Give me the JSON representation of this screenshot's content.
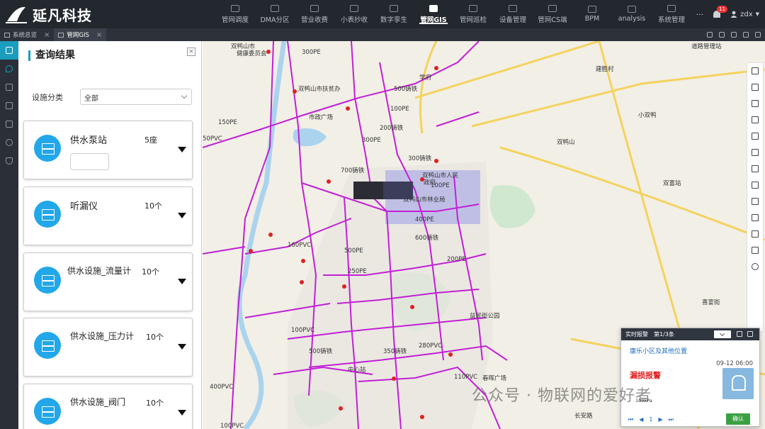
{
  "app": {
    "title": "延凡科技"
  },
  "nav": {
    "items": [
      {
        "label": "管网调度"
      },
      {
        "label": "DMA分区"
      },
      {
        "label": "营业收费"
      },
      {
        "label": "小表抄收"
      },
      {
        "label": "数字孪生"
      },
      {
        "label": "管网GIS",
        "active": true
      },
      {
        "label": "管网巡检"
      },
      {
        "label": "设备管理"
      },
      {
        "label": "管网CS端"
      },
      {
        "label": "BPM"
      },
      {
        "label": "analysis"
      },
      {
        "label": "系统管理"
      }
    ],
    "more": "···",
    "badge": "11",
    "user": "zdx"
  },
  "tabs": [
    {
      "label": "系统总览",
      "close": "×"
    },
    {
      "label": "管网GIS",
      "close": "×",
      "active": true
    }
  ],
  "panel": {
    "title": "查询结果",
    "close": "×",
    "category_label": "设施分类",
    "category_value": "全部",
    "cards": [
      {
        "name": "供水泵站",
        "count": "5座"
      },
      {
        "name": "听漏仪",
        "count": "10个"
      },
      {
        "name": "供水设施_流量计",
        "count": "10个"
      },
      {
        "name": "供水设施_压力计",
        "count": "10个"
      },
      {
        "name": "供水设施_阀门",
        "count": "10个"
      }
    ]
  },
  "map": {
    "labels": [
      "双鸭山市",
      "健康委员会",
      "双鸭山市扶贫办",
      "市政广场",
      "300PE",
      "700铸铁",
      "150PE",
      "500铸铁",
      "学府",
      "建胜村",
      "小双鸭",
      "100PE",
      "50PVC",
      "200铸铁",
      "300铸铁",
      "300PE",
      "双鸭山市人民",
      "政府",
      "双鸭山市林业局",
      "双鸭山",
      "双富站",
      "400PE",
      "160PVC",
      "500PE",
      "250PE",
      "600铸铁",
      "100PVC",
      "500铸铁",
      "350铸铁",
      "280PVC",
      "110PVC",
      "中心站",
      "春晖广场",
      "益民街公园",
      "喜宴街",
      "道路管理站",
      "长安路",
      "200PE",
      "400PVC",
      "100PVC",
      "100PE"
    ]
  },
  "alarm": {
    "title": "实时报警",
    "page": "第1/3条",
    "location": "康乐小区及其他位置",
    "time": "09-12 06:00",
    "type": "漏损报警",
    "extra": "109kPa",
    "pager": [
      "⏮",
      "◀",
      "1",
      "▶",
      "⏭"
    ],
    "confirm": "确认"
  },
  "watermark": "公众号 · 物联网的爱好者",
  "colors": {
    "accent": "#1a9dbe",
    "pipe": "#c21fd6",
    "topbar": "#23272e",
    "alarm_red": "#e02020",
    "confirm": "#3aa142"
  }
}
